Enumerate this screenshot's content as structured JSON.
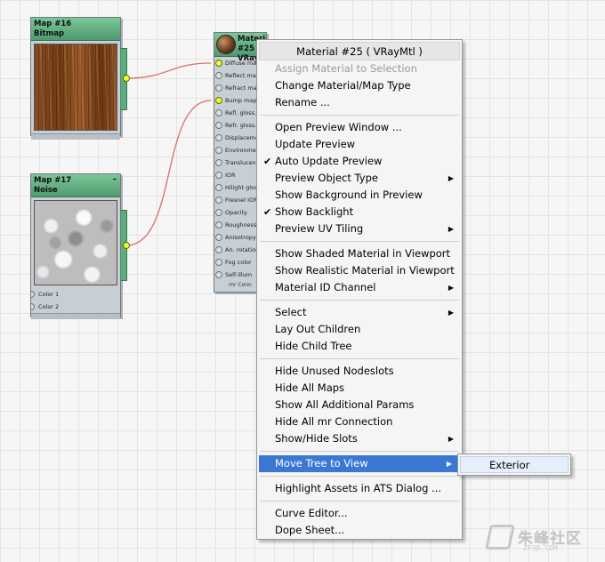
{
  "nodes": {
    "map16": {
      "title_line1": "Map #16",
      "title_line2": "Bitmap"
    },
    "map17": {
      "title_line1": "Map #17",
      "title_line2": "Noise",
      "minimize": "–",
      "slots": [
        "Color 1",
        "Color 2"
      ]
    },
    "material25": {
      "title_line1": "Material #25",
      "title_line2": "VRay",
      "slots": [
        "Diffuse map",
        "Reflect map",
        "Refract map",
        "Bump map",
        "Refl. gloss.",
        "Refr. gloss.",
        "Displacement",
        "Environment",
        "Translucency",
        "IOR",
        "Hilight gloss",
        "Fresnel IOR",
        "Opacity",
        "Roughness",
        "Anisotropy",
        "An. rotation",
        "Fog color",
        "Self-illum"
      ],
      "footer": "mr Conn"
    }
  },
  "context_menu": {
    "title": "Material #25  ( VRayMtl )",
    "groups": [
      [
        {
          "label": "Assign Material to Selection",
          "disabled": true
        },
        {
          "label": "Change Material/Map Type"
        },
        {
          "label": "Rename ..."
        }
      ],
      [
        {
          "label": "Open Preview Window ..."
        },
        {
          "label": "Update Preview"
        },
        {
          "label": "Auto Update Preview",
          "checked": true
        },
        {
          "label": "Preview Object Type",
          "submenu": true
        },
        {
          "label": "Show Background in Preview"
        },
        {
          "label": "Show Backlight",
          "checked": true
        },
        {
          "label": "Preview UV Tiling",
          "submenu": true
        }
      ],
      [
        {
          "label": "Show Shaded Material in Viewport"
        },
        {
          "label": "Show Realistic Material in Viewport"
        },
        {
          "label": "Material ID Channel",
          "submenu": true
        }
      ],
      [
        {
          "label": "Select",
          "submenu": true
        },
        {
          "label": "Lay Out Children"
        },
        {
          "label": "Hide Child Tree"
        }
      ],
      [
        {
          "label": "Hide Unused Nodeslots"
        },
        {
          "label": "Hide All Maps"
        },
        {
          "label": "Show All Additional Params"
        },
        {
          "label": "Hide All mr Connection"
        },
        {
          "label": "Show/Hide Slots",
          "submenu": true
        }
      ],
      [
        {
          "label": "Move Tree to View",
          "submenu": true,
          "highlighted": true
        }
      ],
      [
        {
          "label": "Highlight Assets in ATS Dialog ..."
        }
      ],
      [
        {
          "label": "Curve Editor..."
        },
        {
          "label": "Dope Sheet..."
        }
      ]
    ],
    "check_glyph": "✔",
    "arrow_glyph": "▶"
  },
  "submenu": {
    "items": [
      "Exterior"
    ]
  },
  "watermark": {
    "text": "朱峰社区",
    "sub": "ZF3D.COM"
  },
  "colors": {
    "node_header": "#5fae80",
    "wire": "#e06a6a",
    "socket_active": "#e8ff3a",
    "menu_highlight": "#3a78d4"
  },
  "icons": {
    "material_preview": "material-sphere-icon",
    "check": "checkmark-icon",
    "submenu": "submenu-arrow-icon",
    "socket": "socket-icon"
  }
}
